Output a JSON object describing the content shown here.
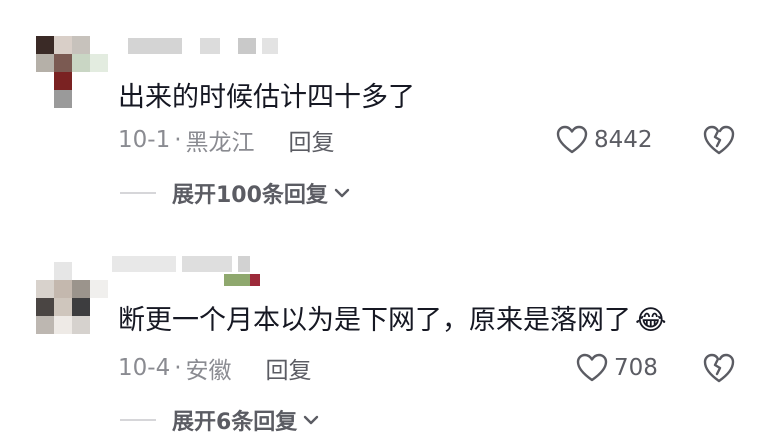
{
  "comments": [
    {
      "text": "出来的时候估计四十多了",
      "date": "10-1",
      "separator": "·",
      "location": "黑龙江",
      "reply_label": "回复",
      "likes": "8442",
      "expand_label": "展开100条回复"
    },
    {
      "text": "断更一个月本以为是下网了，原来是落网了",
      "emoji": "😂",
      "date": "10-4",
      "separator": "·",
      "location": "安徽",
      "reply_label": "回复",
      "likes": "708",
      "expand_label": "展开6条回复"
    }
  ],
  "icons": {
    "like": "heart-outline-icon",
    "dislike": "broken-heart-icon",
    "expand": "chevron-down-icon"
  },
  "colors": {
    "text": "#161823",
    "meta": "#8a8b91",
    "secondary": "#5b5c63",
    "divider": "#d6d6d9"
  }
}
